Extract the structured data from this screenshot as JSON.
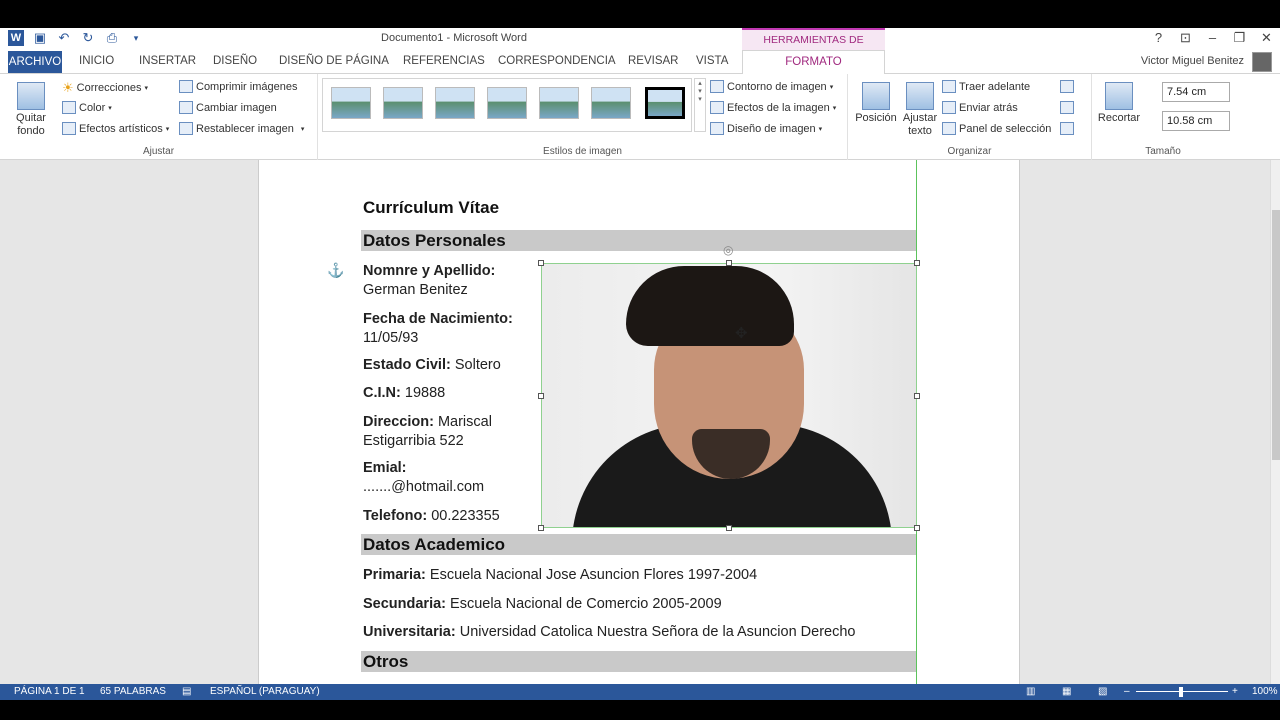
{
  "titlebar": {
    "doc_title": "Documento1 - Microsoft Word",
    "context_group": "HERRAMIENTAS DE IMAGEN",
    "help": "?",
    "controls": [
      "⊡",
      "–",
      "❐",
      "✕"
    ]
  },
  "tabs": {
    "file": "ARCHIVO",
    "items": [
      "INICIO",
      "INSERTAR",
      "DISEÑO",
      "DISEÑO DE PÁGINA",
      "REFERENCIAS",
      "CORRESPONDENCIA",
      "REVISAR",
      "VISTA"
    ],
    "active": "FORMATO",
    "user": "Victor Miguel Benitez"
  },
  "ribbon": {
    "ajustar": {
      "label": "Ajustar",
      "quitar_fondo": "Quitar fondo",
      "correcciones": "Correcciones",
      "color": "Color",
      "efectos_artisticos": "Efectos artísticos",
      "comprimir": "Comprimir imágenes",
      "cambiar": "Cambiar imagen",
      "restablecer": "Restablecer imagen"
    },
    "estilos": {
      "label": "Estilos de imagen",
      "contorno": "Contorno de imagen",
      "efectos": "Efectos de la imagen",
      "diseno": "Diseño de imagen"
    },
    "organizar": {
      "label": "Organizar",
      "posicion": "Posición",
      "ajustar_texto": "Ajustar texto",
      "traer_adelante": "Traer adelante",
      "enviar_atras": "Enviar atrás",
      "panel_seleccion": "Panel de selección"
    },
    "tamano": {
      "label": "Tamaño",
      "recortar": "Recortar",
      "height": "7.54 cm",
      "width": "10.58 cm"
    }
  },
  "document": {
    "title": "Currículum Vítae",
    "section_personal": "Datos Personales",
    "section_academic": "Datos Academico",
    "section_others": "Otros",
    "name_label": "Nomnre y Apellido:",
    "name_value": "German Benitez",
    "birth_label": "Fecha de Nacimiento:",
    "birth_value": "11/05/93",
    "civil_label": "Estado Civil:",
    "civil_value": "Soltero",
    "cin_label": "C.I.N:",
    "cin_value": "19888",
    "address_label": "Direccion:",
    "address_value1": "Mariscal",
    "address_value2": "Estigarribia 522",
    "email_label": "Emial:",
    "email_value": ".......@hotmail.com",
    "phone_label": "Telefono:",
    "phone_value": "00.223355",
    "primaria_label": "Primaria:",
    "primaria_value": "Escuela Nacional Jose Asuncion Flores  1997-2004",
    "secundaria_label": "Secundaria:",
    "secundaria_value": "Escuela Nacional de Comercio 2005-2009",
    "universitaria_label": "Universitaria:",
    "universitaria_value": "Universidad Catolica Nuestra Señora de la Asuncion  Derecho"
  },
  "status": {
    "page": "PÁGINA 1 DE 1",
    "words": "65 PALABRAS",
    "language": "ESPAÑOL (PARAGUAY)",
    "zoom": "100%"
  }
}
